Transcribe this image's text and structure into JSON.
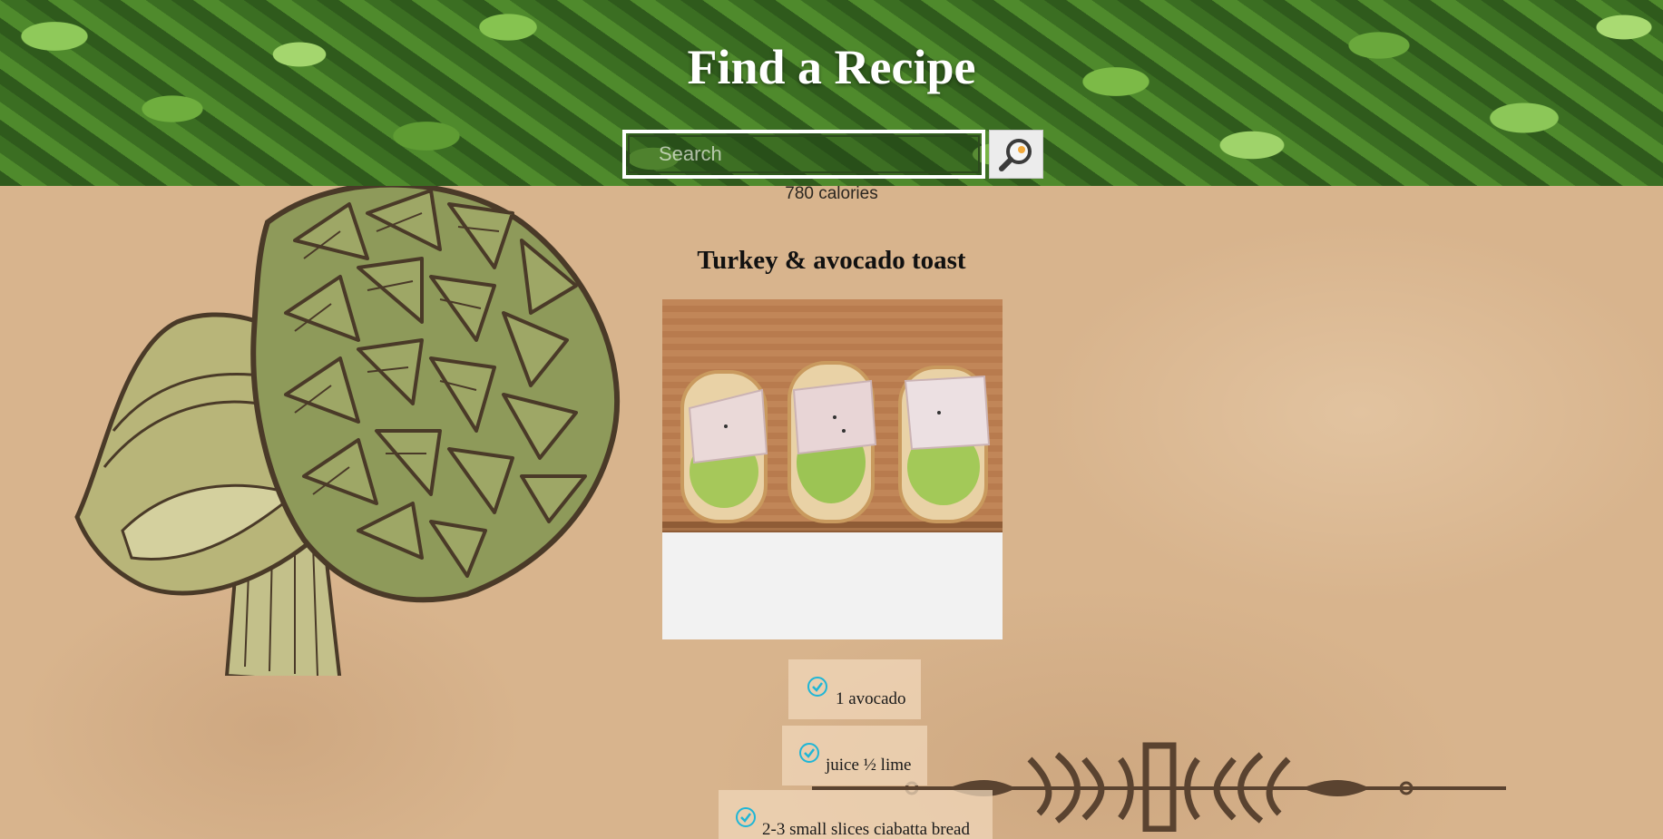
{
  "header": {
    "title": "Find a Recipe",
    "search_placeholder": "Search",
    "search_button_icon": "magnifier-icon"
  },
  "recipe": {
    "calories": "780 calories",
    "title": "Turkey & avocado toast",
    "ingredients": [
      "1 avocado",
      "juice ½ lime",
      "2-3 small slices ciabatta bread"
    ]
  },
  "colors": {
    "parchment": "#d8b48d",
    "artichoke_dark": "#4a3a28",
    "artichoke_green": "#8e9a5a",
    "check_icon": "#1fb6d6"
  }
}
